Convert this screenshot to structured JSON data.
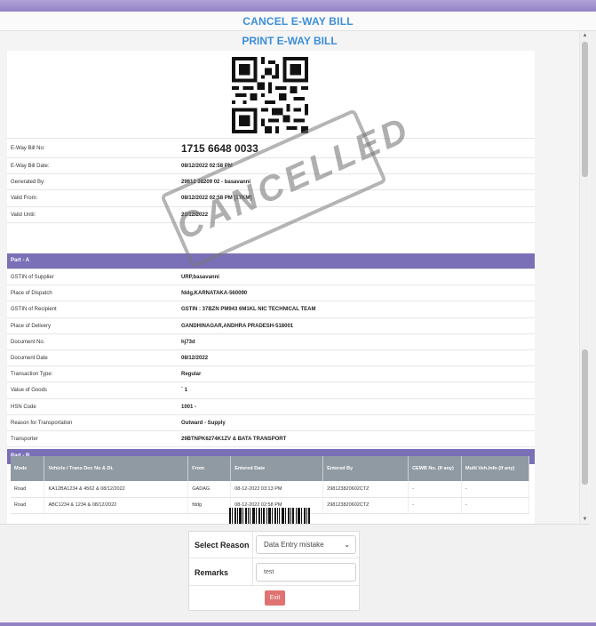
{
  "header": {
    "cancel_title": "CANCEL E-WAY BILL",
    "print_title": "PRINT E-WAY BILL"
  },
  "stamp": {
    "text": "CANCELLED"
  },
  "bill": {
    "rows": [
      {
        "label": "E-Way Bill No:",
        "value": "1715 6648 0033"
      },
      {
        "label": "E-Way Bill Date:",
        "value": "08/12/2022 02:58 PM"
      },
      {
        "label": "Generated By:",
        "value": "29812 38209 02 - basavanni"
      },
      {
        "label": "Valid From:",
        "value": "08/12/2022 02:58 PM [17KM]"
      },
      {
        "label": "Valid Until:",
        "value": "21/12/2022"
      }
    ]
  },
  "part_a": {
    "title": "Part - A",
    "rows": [
      {
        "label": "GSTIN of Supplier",
        "value": "URP,basavanni"
      },
      {
        "label": "Place of Dispatch",
        "value": "fddg,KARNATAKA-560090"
      },
      {
        "label": "GSTIN of Recipient",
        "value": "GSTIN : 37BZN PM943 6M1KL NIC TECHNICAL TEAM"
      },
      {
        "label": "Place of Delivery",
        "value": "GANDHINAGAR,ANDHRA PRADESH-518001"
      },
      {
        "label": "Document No.",
        "value": "hj73d"
      },
      {
        "label": "Document Date",
        "value": "08/12/2022"
      },
      {
        "label": "Transaction Type:",
        "value": "Regular"
      },
      {
        "label": "Value of Goods",
        "value": "` 1"
      },
      {
        "label": "HSN Code",
        "value": "1001 -"
      },
      {
        "label": "Reason for Transportation",
        "value": "Outward - Supply"
      },
      {
        "label": "Transporter",
        "value": "29BTNPK6274K1ZV & BATA TRANSPORT"
      }
    ]
  },
  "part_b": {
    "title": "Part - B",
    "columns": [
      "Mode",
      "Vehicle / Trans Doc No & Dt.",
      "From",
      "Entered Date",
      "Entered By",
      "CEWB No. (If any)",
      "Multi Veh.Info (If any)"
    ],
    "rows": [
      [
        "Road",
        "KA12BA1234 & 4562 & 08/12/2022",
        "GADAG",
        "08-12-2022 03:13 PM",
        "298123820602CTZ",
        "-",
        "-"
      ],
      [
        "Road",
        "ABC1234 & 1234 & 08/12/2022",
        "fddg",
        "08-12-2022 02:58 PM",
        "298123820602CTZ",
        "-",
        "-"
      ]
    ]
  },
  "cancel_form": {
    "reason_label": "Select Reason",
    "reason_value": "Data Entry mistake",
    "remarks_label": "Remarks",
    "remarks_value": "test",
    "exit_label": "Exit"
  },
  "icons": {
    "dropdown": "chevron-down-icon",
    "scroll_up": "scroll-up-icon",
    "scroll_down": "scroll-down-icon"
  }
}
